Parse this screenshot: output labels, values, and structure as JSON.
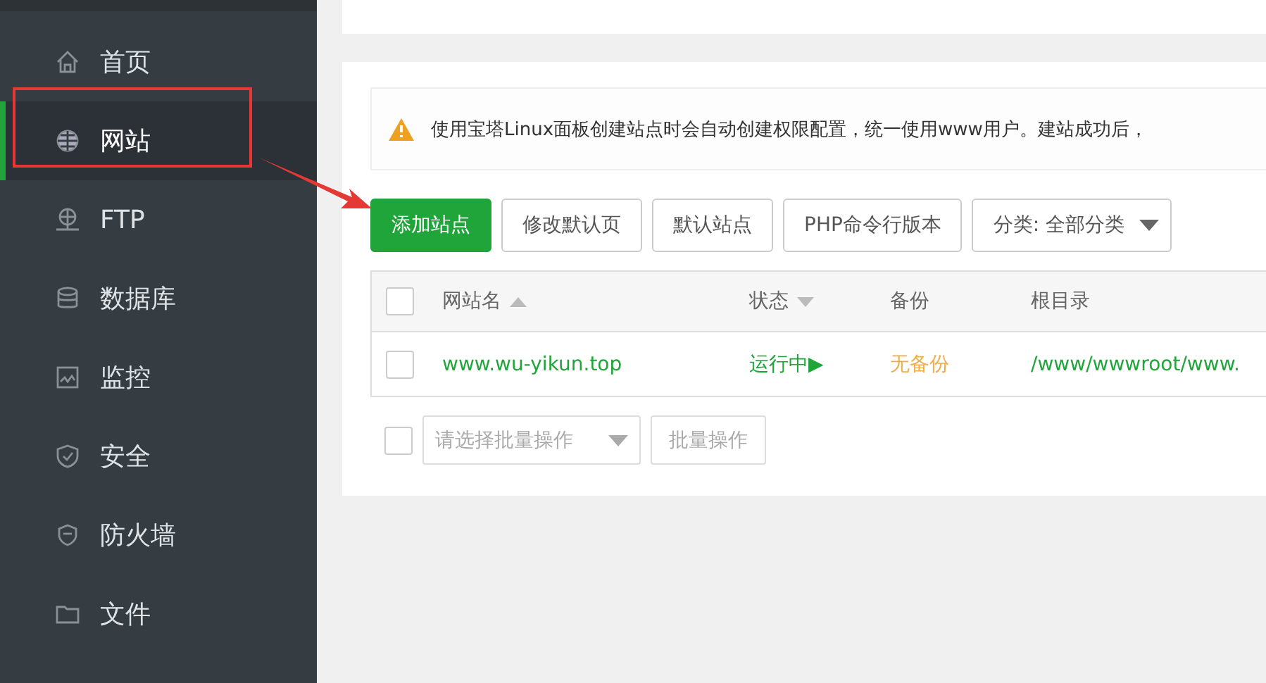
{
  "sidebar": {
    "items": [
      {
        "label": "首页",
        "selected": false
      },
      {
        "label": "网站",
        "selected": true
      },
      {
        "label": "FTP",
        "selected": false
      },
      {
        "label": "数据库",
        "selected": false
      },
      {
        "label": "监控",
        "selected": false
      },
      {
        "label": "安全",
        "selected": false
      },
      {
        "label": "防火墙",
        "selected": false
      },
      {
        "label": "文件",
        "selected": false
      }
    ]
  },
  "alert": {
    "text": "使用宝塔Linux面板创建站点时会自动创建权限配置，统一使用www用户。建站成功后，"
  },
  "toolbar": {
    "buttons": [
      {
        "label": "添加站点",
        "kind": "primary"
      },
      {
        "label": "修改默认页",
        "kind": "default"
      },
      {
        "label": "默认站点",
        "kind": "default"
      },
      {
        "label": "PHP命令行版本",
        "kind": "default"
      }
    ],
    "category": "分类: 全部分类"
  },
  "table": {
    "columns": [
      {
        "label": "网站名",
        "kind": "ascending"
      },
      {
        "label": "状态",
        "kind": "descending"
      },
      {
        "label": "备份",
        "kind": "plain"
      },
      {
        "label": "根目录",
        "kind": "plain"
      }
    ],
    "rows": [
      {
        "checked": false,
        "name": "www.wu-yikun.top",
        "status": "运行中▶",
        "backup": "无备份",
        "root": "/www/wwwroot/www."
      }
    ],
    "header_checked": false
  },
  "batch": {
    "checked": false,
    "placeholder": "请选择批量操作",
    "button": "批量操作"
  }
}
